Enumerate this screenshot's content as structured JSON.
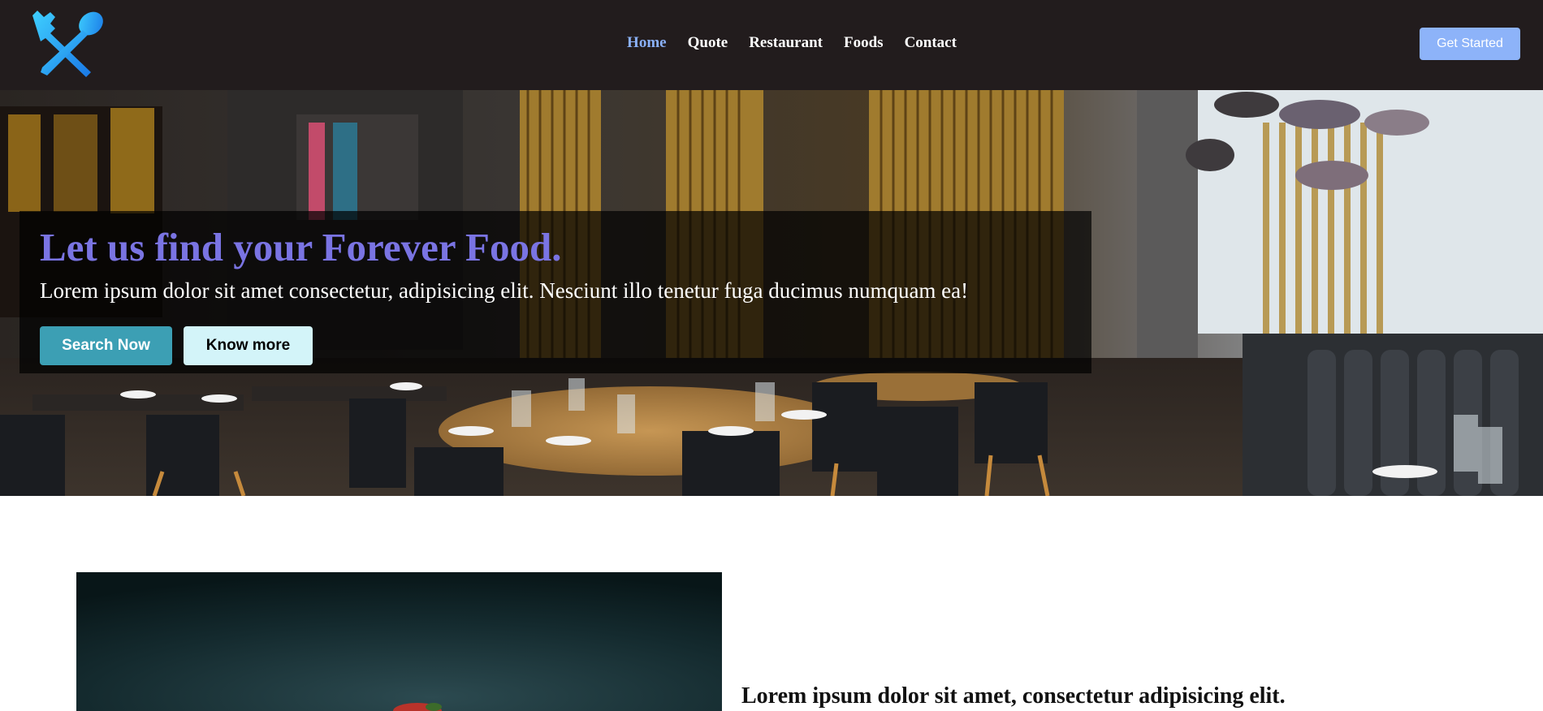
{
  "navbar": {
    "logo_icon": "spoon-fork-crossed-icon",
    "links": [
      {
        "label": "Home",
        "active": true
      },
      {
        "label": "Quote",
        "active": false
      },
      {
        "label": "Restaurant",
        "active": false
      },
      {
        "label": "Foods",
        "active": false
      },
      {
        "label": "Contact",
        "active": false
      }
    ],
    "cta_label": "Get Started"
  },
  "hero": {
    "title": "Let us find your Forever Food.",
    "subtitle": "Lorem ipsum dolor sit amet consectetur, adipisicing elit. Nesciunt illo tenetur fuga ducimus numquam ea!",
    "primary_button": "Search Now",
    "secondary_button": "Know more",
    "background_image": "restaurant-interior-photo"
  },
  "feature": {
    "image": "dark-food-photo",
    "heading": "Lorem ipsum dolor sit amet, consectetur adipisicing elit."
  },
  "colors": {
    "navbar_bg": "#221c1d",
    "active_link": "#8ab0f7",
    "cta_bg": "#8db3f9",
    "hero_title": "#7a74e3",
    "search_button": "#3c9fb4",
    "know_more_button": "#d3f4f9"
  }
}
